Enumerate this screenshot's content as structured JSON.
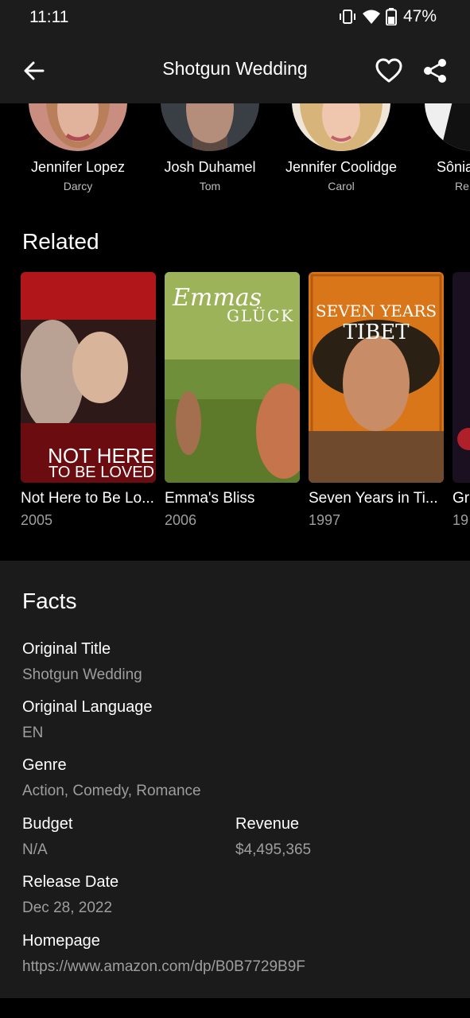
{
  "status": {
    "time": "11:11",
    "battery": "47%"
  },
  "app_bar": {
    "title": "Shotgun Wedding",
    "back_icon": "arrow-left-icon",
    "favorite_icon": "heart-outline-icon",
    "share_icon": "share-icon"
  },
  "cast": [
    {
      "name": "Jennifer Lopez",
      "role": "Darcy"
    },
    {
      "name": "Josh Duhamel",
      "role": "Tom"
    },
    {
      "name": "Jennifer Coolidge",
      "role": "Carol"
    },
    {
      "name": "Sônia",
      "role": "Re"
    }
  ],
  "related": {
    "title": "Related",
    "items": [
      {
        "title": "Not Here to Be Lo...",
        "year": "2005",
        "poster_text": "NOT HERE TO BE LOVED"
      },
      {
        "title": "Emma's Bliss",
        "year": "2006",
        "poster_text": "Emmas GLÜCK"
      },
      {
        "title": "Seven Years in Ti...",
        "year": "1997",
        "poster_text": "SEVEN YEARS IN TIBET"
      },
      {
        "title": "Gr",
        "year": "19"
      }
    ]
  },
  "facts": {
    "title": "Facts",
    "original_title_label": "Original Title",
    "original_title": "Shotgun Wedding",
    "original_language_label": "Original Language",
    "original_language": "EN",
    "genre_label": "Genre",
    "genre": "Action, Comedy, Romance",
    "budget_label": "Budget",
    "budget": "N/A",
    "revenue_label": "Revenue",
    "revenue": "$4,495,365",
    "release_date_label": "Release Date",
    "release_date": "Dec 28, 2022",
    "homepage_label": "Homepage",
    "homepage": "https://www.amazon.com/dp/B0B7729B9F"
  }
}
